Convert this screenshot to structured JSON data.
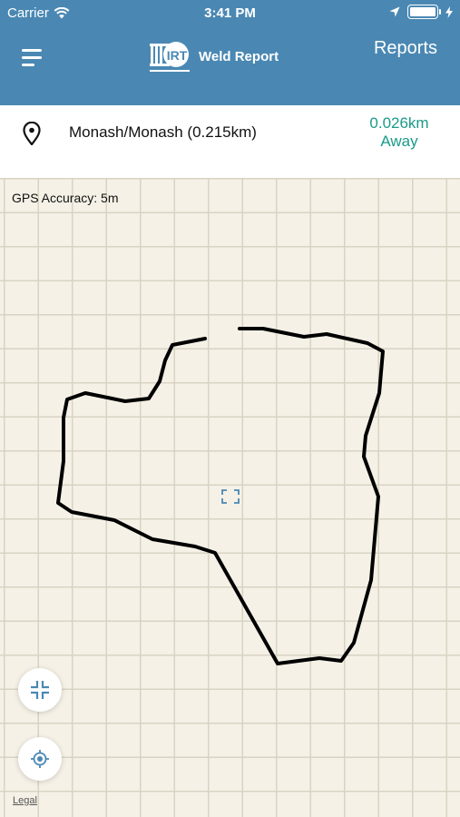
{
  "status_bar": {
    "carrier": "Carrier",
    "time": "3:41 PM"
  },
  "header": {
    "brand": "Weld Report",
    "logo_text": "IRT",
    "reports_label": "Reports"
  },
  "location": {
    "name": "Monash/Monash (0.215km)",
    "distance_value": "0.026km",
    "distance_suffix": "Away"
  },
  "map": {
    "gps_accuracy": "GPS Accuracy: 5m",
    "legal_label": "Legal"
  },
  "colors": {
    "header_bg": "#4a88b3",
    "accent_teal": "#1a9a8a",
    "map_bg": "#f5f1e6",
    "grid_line": "#d9d3c4",
    "control_icon": "#4a88b3"
  },
  "icons": [
    "wifi-icon",
    "location-arrow-icon",
    "battery-icon",
    "menu-icon",
    "location-pin-icon",
    "center-target-icon",
    "collapse-icon",
    "locate-icon"
  ]
}
